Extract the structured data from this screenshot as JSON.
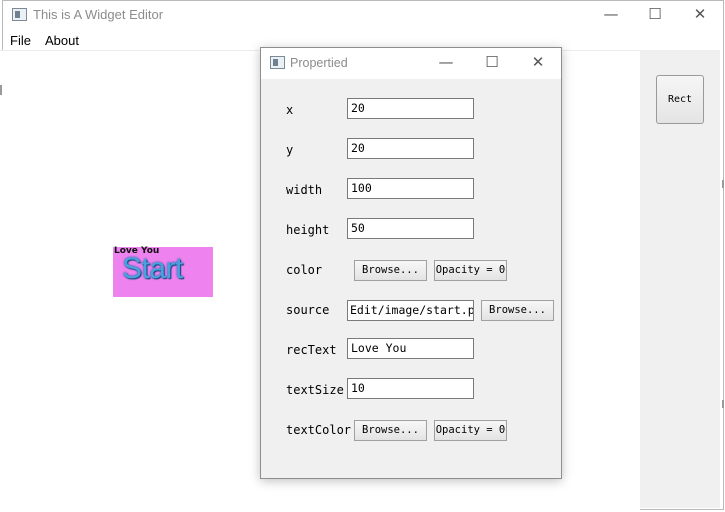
{
  "main_window": {
    "title": "This is A Widget Editor",
    "menu": [
      "File",
      "About"
    ],
    "controls": {
      "minimize": "—",
      "maximize": "☐",
      "close": "✕"
    }
  },
  "toolbox": {
    "rect_button": "Rect"
  },
  "canvas_widget": {
    "text": "Love You",
    "image_text": "Start",
    "color": "#ee82ee"
  },
  "dialog": {
    "title": "Propertied",
    "controls": {
      "minimize": "—",
      "maximize": "☐",
      "close": "✕"
    },
    "rows": {
      "x": {
        "label": "x",
        "value": "20"
      },
      "y": {
        "label": "y",
        "value": "20"
      },
      "width": {
        "label": "width",
        "value": "100"
      },
      "height": {
        "label": "height",
        "value": "50"
      },
      "color": {
        "label": "color",
        "browse": "Browse...",
        "opacity": "Opacity = 0"
      },
      "source": {
        "label": "source",
        "value": "Edit/image/start.png",
        "browse": "Browse..."
      },
      "recText": {
        "label": "recText",
        "value": "Love You"
      },
      "textSize": {
        "label": "textSize",
        "value": "10"
      },
      "textColor": {
        "label": "textColor",
        "browse": "Browse...",
        "opacity": "Opacity = 0"
      }
    }
  }
}
